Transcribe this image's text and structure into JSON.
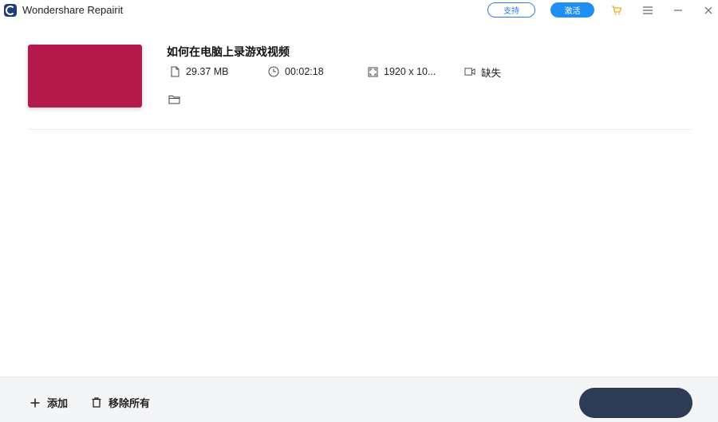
{
  "app": {
    "title": "Wondershare Repairit"
  },
  "titlebar": {
    "support_label": "支持",
    "activate_label": "激活",
    "icons": [
      "cart-icon",
      "menu-icon",
      "minimize-icon",
      "close-icon"
    ],
    "colors": {
      "support": "#2a7ff0",
      "activate": "#1f8ef5",
      "cart": "#f5a623"
    }
  },
  "file": {
    "name": "如何在电脑上录游戏视频",
    "size": "29.37  MB",
    "duration": "00:02:18",
    "resolution": "1920 x 10...",
    "codec": "缺失",
    "thumbnail_color": "#b51a4d"
  },
  "footer": {
    "add_label": "添加",
    "remove_all_label": "移除所有",
    "repair_label": ""
  }
}
